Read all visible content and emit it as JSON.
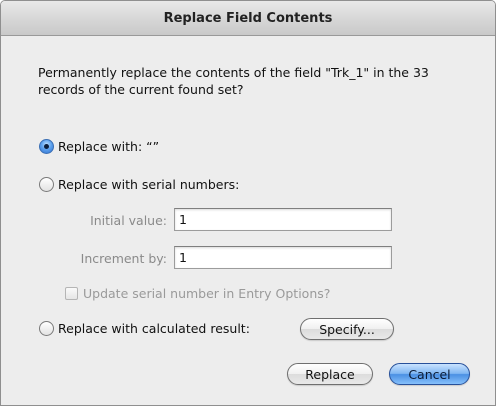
{
  "window": {
    "title": "Replace Field Contents"
  },
  "message": "Permanently replace the contents of the field \"Trk_1\" in the 33 records of the current found set?",
  "options": {
    "replace_with_label": "Replace with: “”",
    "replace_with_selected": true,
    "serial_label": "Replace with serial numbers:",
    "calculated_label": "Replace with calculated result:"
  },
  "serial": {
    "initial_label": "Initial value:",
    "initial_value": "1",
    "increment_label": "Increment by:",
    "increment_value": "1",
    "update_checkbox_label": "Update serial number in Entry Options?",
    "update_checked": false
  },
  "buttons": {
    "specify_label": "Specify...",
    "replace_label": "Replace",
    "cancel_label": "Cancel"
  },
  "colors": {
    "default_button": "#4a8fe3",
    "disabled_text": "#8a8a8a"
  }
}
